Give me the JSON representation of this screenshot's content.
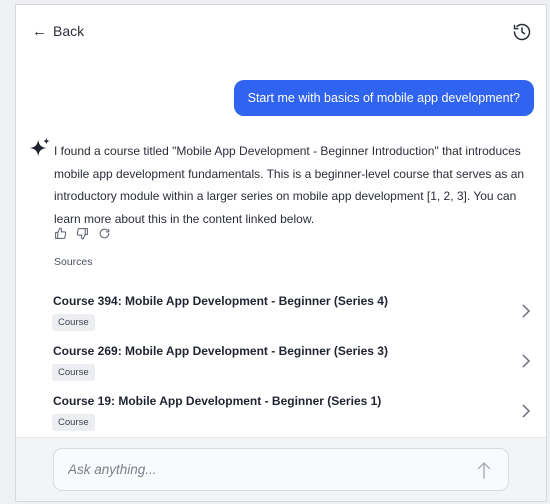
{
  "header": {
    "back_label": "Back",
    "back_icon": "arrow-left-icon",
    "history_icon": "history-icon"
  },
  "chat": {
    "user_message": "Start me with basics of mobile app development?",
    "assistant_icon": "sparkle-icon",
    "assistant_message": "I found a course titled \"Mobile App Development - Beginner Introduction\" that introduces mobile app development fundamentals. This is a beginner-level course that serves as an introductory module within a larger series on mobile app development [1, 2, 3]. You can learn more about this in the content linked below.",
    "feedback_icons": [
      "thumbs-up-icon",
      "thumbs-down-icon",
      "regenerate-icon"
    ]
  },
  "sources": {
    "label": "Sources",
    "items": [
      {
        "title": "Course 394: Mobile App Development - Beginner (Series 4)",
        "tag": "Course"
      },
      {
        "title": "Course 269: Mobile App Development - Beginner (Series 3)",
        "tag": "Course"
      },
      {
        "title": "Course 19: Mobile App Development - Beginner (Series 1)",
        "tag": "Course"
      }
    ]
  },
  "composer": {
    "placeholder": "Ask anything...",
    "send_icon": "arrow-up-icon"
  },
  "colors": {
    "accent": "#2f63f0",
    "tag_bg": "#eceef1"
  }
}
